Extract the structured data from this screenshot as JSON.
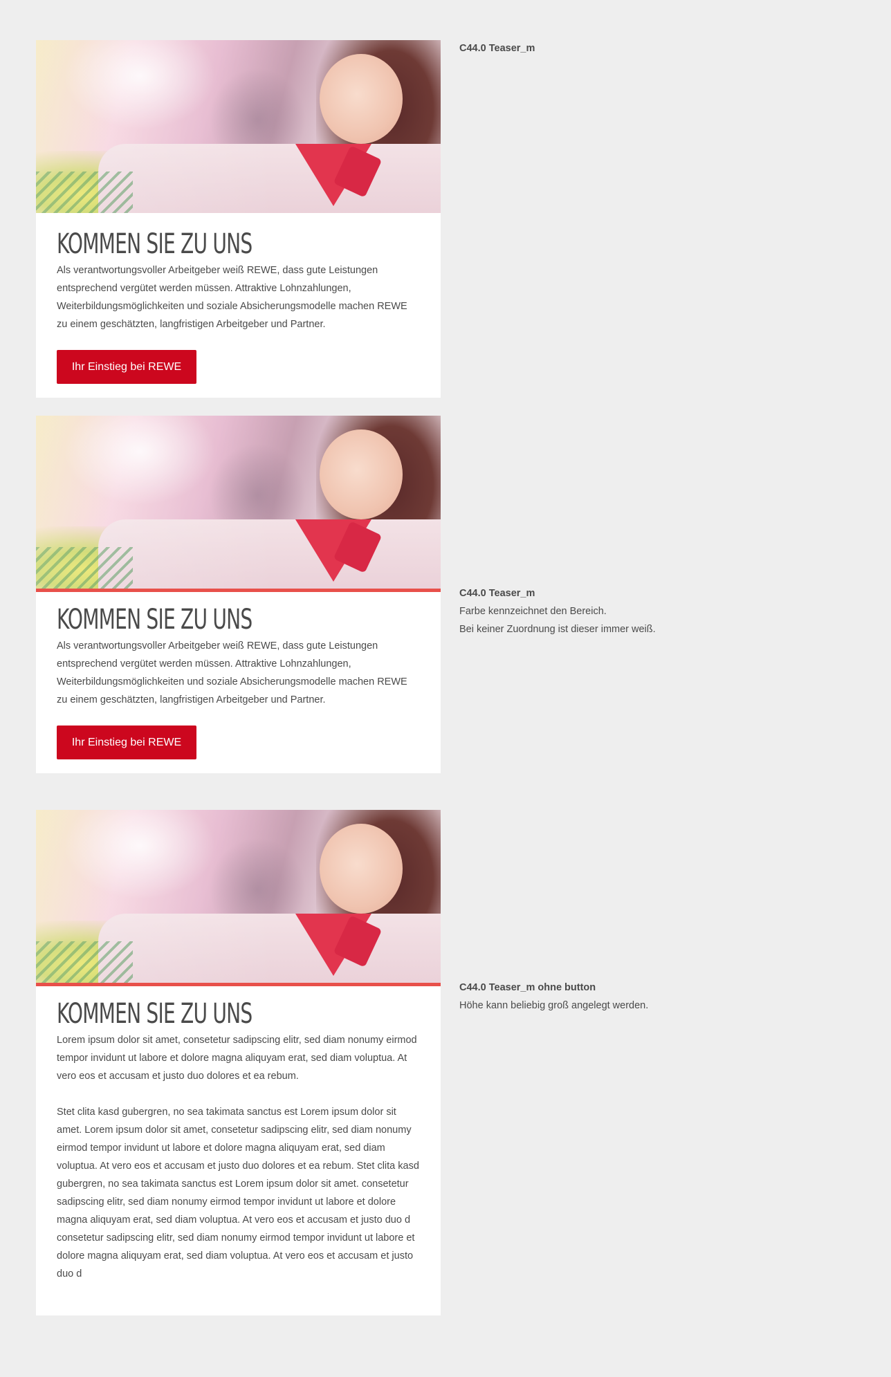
{
  "teasers": [
    {
      "title": "KOMMEN SIE ZU UNS",
      "paragraphs": [
        "Als verantwortungsvoller Arbeitgeber weiß REWE, dass gute Leistungen entsprechend vergütet werden müssen. Attraktive Lohnzahlungen, Weiterbildungsmöglichkeiten und soziale Absicherungsmodelle machen REWE zu einem geschätzten, langfristigen Arbeitgeber und Partner."
      ],
      "button_label": "Ihr Einstieg bei REWE",
      "accent_bar": false
    },
    {
      "title": "KOMMEN SIE ZU UNS",
      "paragraphs": [
        "Als verantwortungsvoller Arbeitgeber weiß REWE, dass gute Leistungen entsprechend vergütet werden müssen. Attraktive Lohnzahlungen, Weiterbildungsmöglichkeiten und soziale Absicherungsmodelle machen REWE zu einem geschätzten, langfristigen Arbeitgeber und Partner."
      ],
      "button_label": "Ihr Einstieg bei REWE",
      "accent_bar": true
    },
    {
      "title": "KOMMEN SIE ZU UNS",
      "paragraphs": [
        "Lorem ipsum dolor sit amet, consetetur sadipscing elitr, sed diam nonumy eirmod tempor invidunt ut labore et dolore magna aliquyam erat, sed diam voluptua. At vero eos et accusam et justo duo dolores et ea rebum.",
        "Stet clita kasd gubergren, no sea takimata sanctus est Lorem ipsum dolor sit amet. Lorem ipsum dolor sit amet, consetetur sadipscing elitr, sed diam nonumy eirmod tempor invidunt ut labore et dolore magna aliquyam erat, sed diam voluptua. At vero eos et accusam et justo duo dolores et ea rebum. Stet clita kasd gubergren, no sea takimata sanctus est Lorem ipsum dolor sit amet. consetetur sadipscing elitr, sed diam nonumy eirmod tempor invidunt ut labore et dolore magna aliquyam erat, sed diam voluptua. At vero eos et accusam et justo duo d consetetur sadipscing elitr, sed diam nonumy eirmod tempor invidunt ut labore et dolore magna aliquyam erat, sed diam voluptua. At vero eos et accusam et justo duo d"
      ],
      "button_label": null,
      "accent_bar": true
    }
  ],
  "notes": [
    {
      "title": "C44.0 Teaser_m",
      "lines": []
    },
    {
      "title": "C44.0 Teaser_m",
      "lines": [
        "Farbe kennzeichnet den Bereich.",
        "Bei keiner Zuordnung ist dieser immer weiß."
      ]
    },
    {
      "title": "C44.0 Teaser_m ohne button",
      "lines": [
        "Höhe kann beliebig  groß angelegt werden."
      ]
    }
  ],
  "colors": {
    "background": "#eeeeee",
    "card": "#ffffff",
    "button": "#cc071e",
    "accent_bar": "#e8504a",
    "text": "#4a4a4a"
  },
  "image": {
    "icon": "teaser-photo-icon",
    "subject": "smiling shop assistant with red scarf"
  }
}
